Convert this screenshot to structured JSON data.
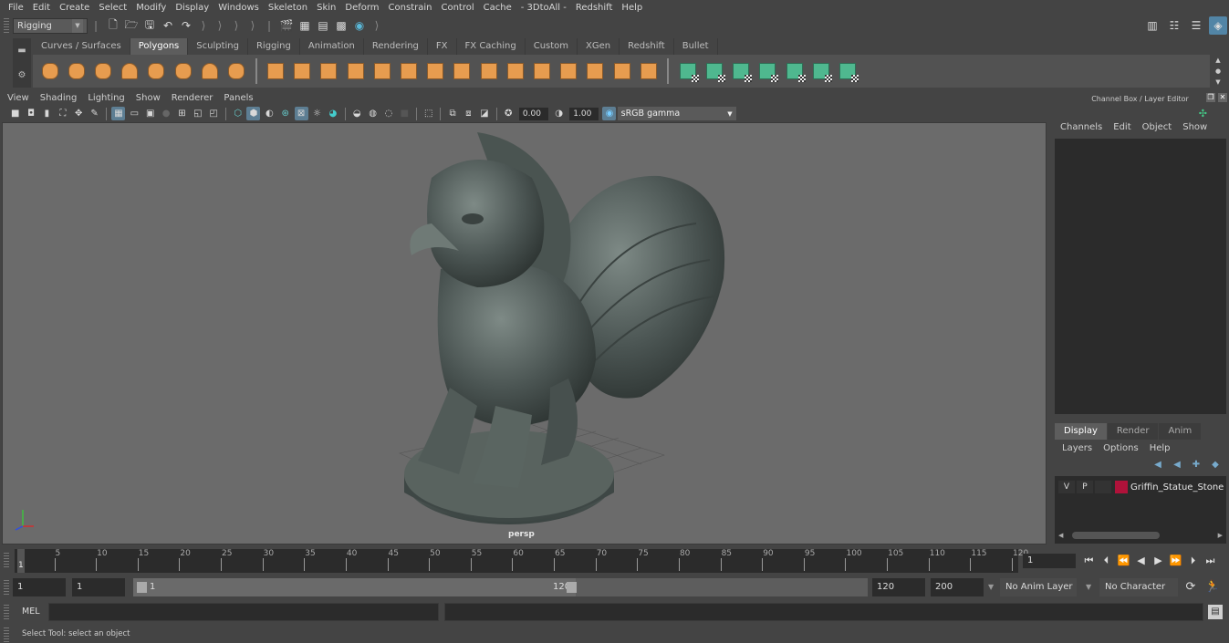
{
  "menubar": {
    "items": [
      "File",
      "Edit",
      "Create",
      "Select",
      "Modify",
      "Display",
      "Windows",
      "Skeleton",
      "Skin",
      "Deform",
      "Constrain",
      "Control",
      "Cache",
      "- 3DtoAll -",
      "Redshift",
      "Help"
    ]
  },
  "statusline": {
    "mode": "Rigging",
    "icons": [
      "new-scene-icon",
      "open-scene-icon",
      "save-scene-icon",
      "undo-icon",
      "redo-icon"
    ],
    "render_icons": [
      "render-frame-icon",
      "render-sequence-icon",
      "ipr-render-icon",
      "render-settings-icon",
      "hypershade-icon"
    ],
    "right_icons": [
      "modeling-toolkit-icon",
      "attribute-editor-icon",
      "tool-settings-icon",
      "channel-box-icon"
    ]
  },
  "shelf": {
    "tabs": [
      "Curves / Surfaces",
      "Polygons",
      "Sculpting",
      "Rigging",
      "Animation",
      "Rendering",
      "FX",
      "FX Caching",
      "Custom",
      "XGen",
      "Redshift",
      "Bullet"
    ],
    "active_tab": "Polygons",
    "primitive_icons": [
      "poly-sphere-icon",
      "poly-cube-icon",
      "poly-cylinder-icon",
      "poly-cone-icon",
      "poly-plane-icon",
      "poly-torus-icon",
      "poly-pyramid-icon",
      "poly-pipe-icon"
    ],
    "tool_icons": [
      "combine-icon",
      "separate-icon",
      "mirror-icon",
      "smooth-icon",
      "bevel-icon",
      "extrude-icon",
      "multi-cut-icon",
      "bridge-icon",
      "append-icon",
      "fill-hole-icon",
      "quad-draw-icon",
      "target-weld-icon",
      "connect-icon",
      "reduce-icon",
      "triangulate-icon"
    ],
    "uv_icons": [
      "planar-map-icon",
      "cylindrical-map-icon",
      "spherical-map-icon",
      "automatic-map-icon",
      "unfold-icon",
      "uv-editor-icon",
      "layout-uv-icon"
    ]
  },
  "viewport": {
    "menu": [
      "View",
      "Shading",
      "Lighting",
      "Show",
      "Renderer",
      "Panels"
    ],
    "exposure": "0.00",
    "gamma": "1.00",
    "color_space": "sRGB gamma",
    "camera_label": "persp"
  },
  "channel_box": {
    "title": "Channel Box / Layer Editor",
    "menu": [
      "Channels",
      "Edit",
      "Object",
      "Show"
    ]
  },
  "layer_editor": {
    "tabs": [
      "Display",
      "Render",
      "Anim"
    ],
    "active_tab": "Display",
    "menu": [
      "Layers",
      "Options",
      "Help"
    ],
    "layers": [
      {
        "visible": "V",
        "playback": "P",
        "color": "#b0123a",
        "name": "Griffin_Statue_Stone"
      }
    ]
  },
  "timeslider": {
    "ticks": [
      5,
      10,
      15,
      20,
      25,
      30,
      35,
      40,
      45,
      50,
      55,
      60,
      65,
      70,
      75,
      80,
      85,
      90,
      95,
      100,
      105,
      110,
      115,
      120
    ],
    "range_start": 1,
    "range_end": 120,
    "current_frame_marker": "1",
    "current_frame": "1"
  },
  "rangebar": {
    "start_time": "1",
    "playback_start": "1",
    "range_min_label": "1",
    "range_max_label": "120",
    "playback_end": "120",
    "end_time": "200",
    "anim_layer": "No Anim Layer",
    "character_set": "No Character Set"
  },
  "cmdline": {
    "language": "MEL"
  },
  "helpline": {
    "text": "Select Tool: select an object"
  },
  "colors": {
    "accent_blue": "#5285a6",
    "shelf_orange": "#e79c4f",
    "shelf_green": "#4fb88f",
    "playback_orange": "#e8913d"
  }
}
